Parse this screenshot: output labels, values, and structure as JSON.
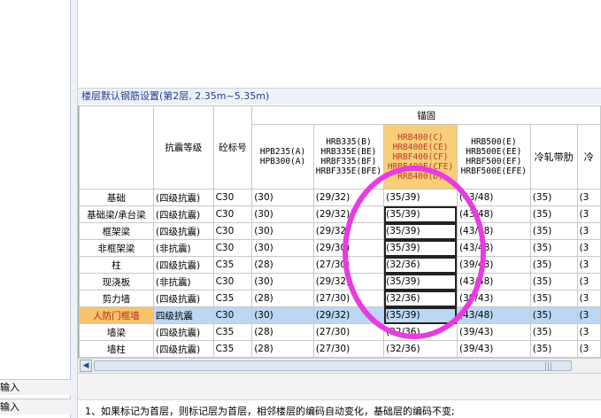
{
  "left_panel": {
    "items": [
      "输入",
      "输入"
    ]
  },
  "section_title": "楼层默认钢筋设置(第2层, 2.35m~5.35m)",
  "table": {
    "group_header": "锚固",
    "headers": {
      "name": "",
      "seismic": "抗震等级",
      "concrete": "砼标号",
      "c1": [
        "HPB235(A)",
        "HPB300(A)"
      ],
      "c2": [
        "HRB335(B)",
        "HRB335E(BE)",
        "HRBF335(BF)",
        "HRBF335E(BFE)"
      ],
      "c3": [
        "HRB400(C)",
        "HRB400E(CE)",
        "HRBF400(CF)",
        "HRBF400E(CFE)",
        "RRB400(D)"
      ],
      "c4": [
        "HRB500(E)",
        "HRB500E(EE)",
        "HRBF500(EF)",
        "HRBF500E(EFE)"
      ],
      "c5": "冷轧带肋",
      "c6": "冷"
    },
    "rows": [
      {
        "name": "基础",
        "seismic": "(四级抗震)",
        "concrete": "C30",
        "c1": "(30)",
        "c2": "(29/32)",
        "c3": "(35/39)",
        "c4": "(43/48)",
        "c5": "(35)",
        "c6": "(3"
      },
      {
        "name": "基础梁/承台梁",
        "seismic": "(四级抗震)",
        "concrete": "C30",
        "c1": "(30)",
        "c2": "(29/32)",
        "c3": "(35/39)",
        "c4": "(43/48)",
        "c5": "(35)",
        "c6": "(3"
      },
      {
        "name": "框架梁",
        "seismic": "(四级抗震)",
        "concrete": "C30",
        "c1": "(30)",
        "c2": "(29/32)",
        "c3": "(35/39)",
        "c4": "(43/48)",
        "c5": "(35)",
        "c6": "(3"
      },
      {
        "name": "非框架梁",
        "seismic": "(非抗震)",
        "concrete": "C30",
        "c1": "(30)",
        "c2": "(29/30)",
        "c3": "(35/39)",
        "c4": "(43/48)",
        "c5": "(35)",
        "c6": "(3"
      },
      {
        "name": "柱",
        "seismic": "(四级抗震)",
        "concrete": "C35",
        "c1": "(28)",
        "c2": "(27/30)",
        "c3": "(32/36)",
        "c4": "(39/43)",
        "c5": "(35)",
        "c6": "(3"
      },
      {
        "name": "现浇板",
        "seismic": "(非抗震)",
        "concrete": "C30",
        "c1": "(30)",
        "c2": "(29/32)",
        "c3": "(35/39)",
        "c4": "(43/48)",
        "c5": "(35)",
        "c6": "(3"
      },
      {
        "name": "剪力墙",
        "seismic": "(四级抗震)",
        "concrete": "C35",
        "c1": "(28)",
        "c2": "(27/30)",
        "c3": "(32/36)",
        "c4": "(39/43)",
        "c5": "(35)",
        "c6": "(3"
      },
      {
        "name": "人防门框墙",
        "seismic": "四级抗震",
        "concrete": "C30",
        "c1": "(30)",
        "c2": "(29/32)",
        "c3": "(35/39)",
        "c4": "(43/48)",
        "c5": "(35)",
        "c6": "(3"
      },
      {
        "name": "墙梁",
        "seismic": "(四级抗震)",
        "concrete": "C35",
        "c1": "(28)",
        "c2": "(27/30)",
        "c3": "(32/36)",
        "c4": "(39/43)",
        "c5": "(35)",
        "c6": "(3"
      },
      {
        "name": "墙柱",
        "seismic": "(四级抗震)",
        "concrete": "C35",
        "c1": "(28)",
        "c2": "(27/30)",
        "c3": "(32/36)",
        "c4": "(39/43)",
        "c5": "(35)",
        "c6": "(3"
      }
    ],
    "highlighted_row": 7,
    "selected_column": "c3"
  },
  "scrollbar": {
    "left_arrow": "◀",
    "grip": "|||"
  },
  "note": "1、如果标记为首层，则标记层为首层，相邻楼层的编码自动变化，基础层的编码不变;",
  "colors": {
    "highlight_row": "#bcd7f3",
    "selected_header": "#f8cf78",
    "annotation_circle": "#e83be0"
  }
}
